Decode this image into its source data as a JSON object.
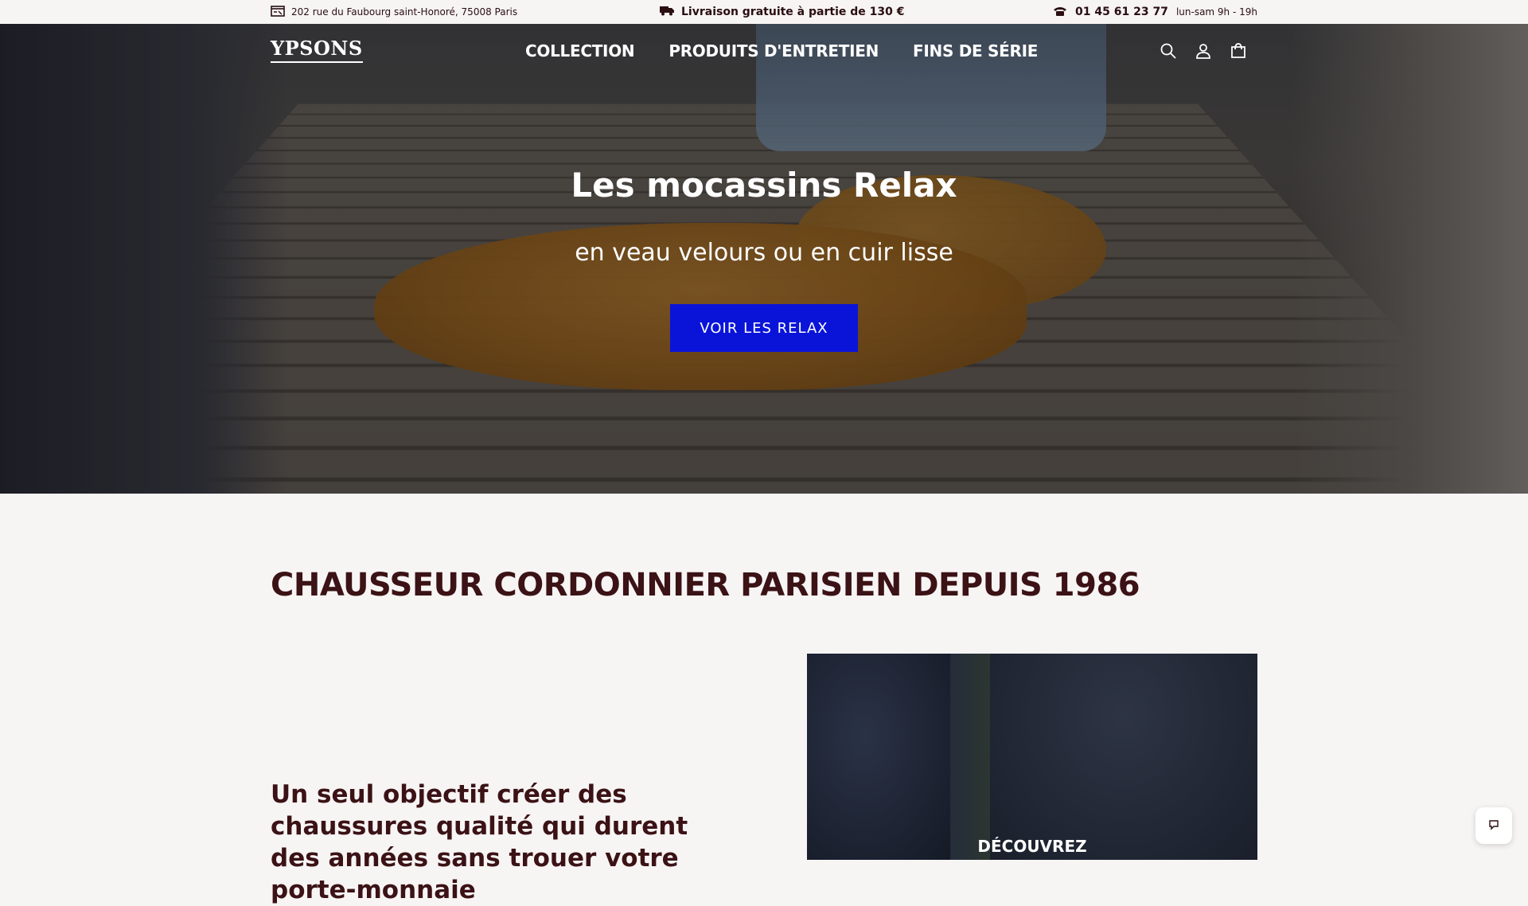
{
  "topbar": {
    "address": "202 rue du Faubourg saint-Honoré, 75008 Paris",
    "shipping": "Livraison gratuite à partie de 130 €",
    "phone": "01 45 61 23 77",
    "hours": "lun-sam 9h - 19h"
  },
  "header": {
    "logo": "YPSONS",
    "nav": [
      "COLLECTION",
      "PRODUITS D'ENTRETIEN",
      "FINS DE SÉRIE"
    ],
    "icons": [
      "search-icon",
      "account-icon",
      "cart-icon"
    ]
  },
  "hero": {
    "title": "Les mocassins Relax",
    "subtitle": "en veau velours ou en cuir lisse",
    "button": "VOIR LES RELAX"
  },
  "section": {
    "title": "CHAUSSEUR CORDONNIER PARISIEN DEPUIS 1986",
    "text": "Un seul objectif créer des chaussures qualité qui durent des années sans trouer votre porte-monnaie",
    "image_cta": "DÉCOUVREZ"
  },
  "colors": {
    "accent": "#0a14d9",
    "heading": "#3b1215",
    "background": "#f7f4f4"
  }
}
